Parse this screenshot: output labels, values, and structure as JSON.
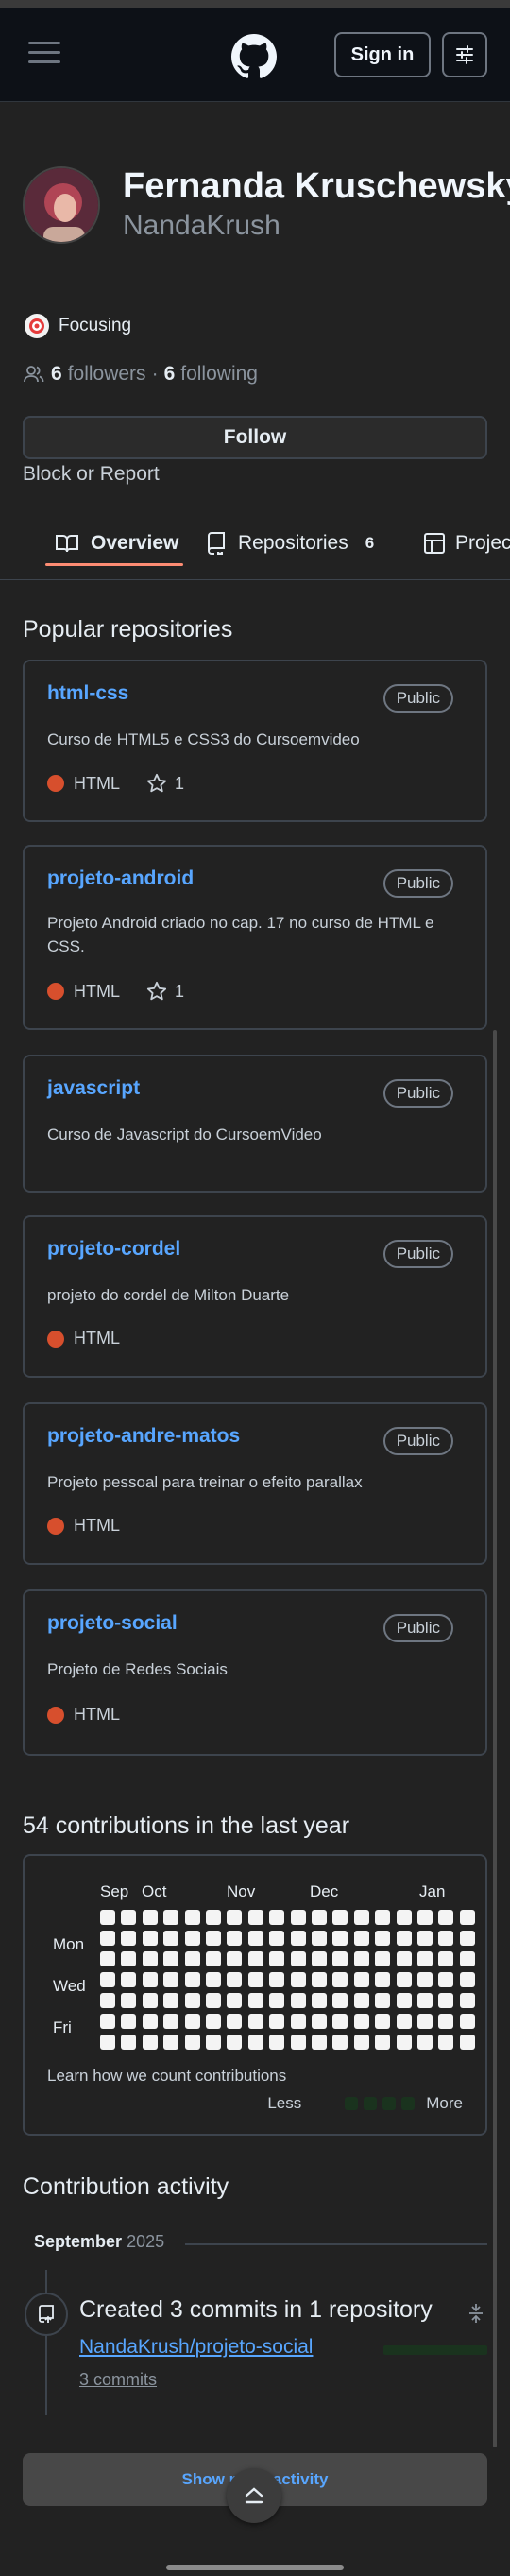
{
  "header": {
    "signin_label": "Sign in",
    "icons": [
      "hamburger-menu-icon",
      "github-mark-icon",
      "settings-sliders-icon"
    ]
  },
  "profile": {
    "name": "Fernanda Kruschewsky",
    "login": "NandaKrush",
    "status_text": "Focusing",
    "status_emoji_icon": "target-icon",
    "followers_count": "6",
    "followers_label": "followers",
    "separator": "·",
    "following_count": "6",
    "following_label": "following",
    "follow_label": "Follow",
    "block_label": "Block or Report"
  },
  "tabs": [
    {
      "label": "Overview",
      "icon": "book-icon",
      "active": true
    },
    {
      "label": "Repositories",
      "icon": "repo-icon",
      "count": "6"
    },
    {
      "label": "Projects",
      "icon": "table-icon"
    }
  ],
  "popular": {
    "title": "Popular repositories",
    "repos": [
      {
        "name": "html-css",
        "visibility": "Public",
        "description": "Curso de HTML5 e CSS3 do Cursoemvideo",
        "language": "HTML",
        "stars": "1"
      },
      {
        "name": "projeto-android",
        "visibility": "Public",
        "description": "Projeto Android criado no cap. 17 no curso de HTML e CSS.",
        "language": "HTML",
        "stars": "1"
      },
      {
        "name": "javascript",
        "visibility": "Public",
        "description": "Curso de Javascript do CursoemVideo"
      },
      {
        "name": "projeto-cordel",
        "visibility": "Public",
        "description": "projeto do cordel de Milton Duarte",
        "language": "HTML"
      },
      {
        "name": "projeto-andre-matos",
        "visibility": "Public",
        "description": "Projeto pessoal para treinar o efeito parallax",
        "language": "HTML"
      },
      {
        "name": "projeto-social",
        "visibility": "Public",
        "description": "Projeto de Redes Sociais",
        "language": "HTML"
      }
    ],
    "language_color": "#e34c26"
  },
  "contributions": {
    "title": "54 contributions in the last year",
    "months": [
      "Sep",
      "Oct",
      "Nov",
      "Dec",
      "Jan"
    ],
    "days": [
      "Mon",
      "Wed",
      "Fri"
    ],
    "learn_label": "Learn how we count contributions",
    "less_label": "Less",
    "more_label": "More"
  },
  "activity": {
    "title": "Contribution activity",
    "month": "September",
    "year": "2025",
    "event_title": "Created 3 commits in 1 repository",
    "event_repo": "NandaKrush/projeto-social",
    "event_commits": "3 commits",
    "show_more_label": "Show more activity"
  },
  "colors": {
    "accent_link": "#58a6ff",
    "tab_underline": "#fd8c73",
    "background": "#222222"
  }
}
